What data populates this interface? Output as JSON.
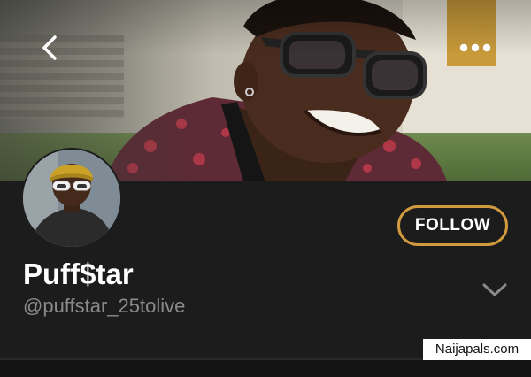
{
  "cover": {
    "back_icon": "chevron-left-icon",
    "more_icon": "more-horizontal-icon"
  },
  "profile": {
    "display_name": "Puff$tar",
    "handle": "@puffstar_25tolive",
    "follow_label": "FOLLOW",
    "expand_icon": "chevron-down-icon"
  },
  "watermark": {
    "text": "Naijapals.com"
  },
  "colors": {
    "background": "#1c1c1c",
    "follow_border": "#d29a3e",
    "name_text": "#ffffff",
    "handle_text": "#8a8a8a"
  }
}
